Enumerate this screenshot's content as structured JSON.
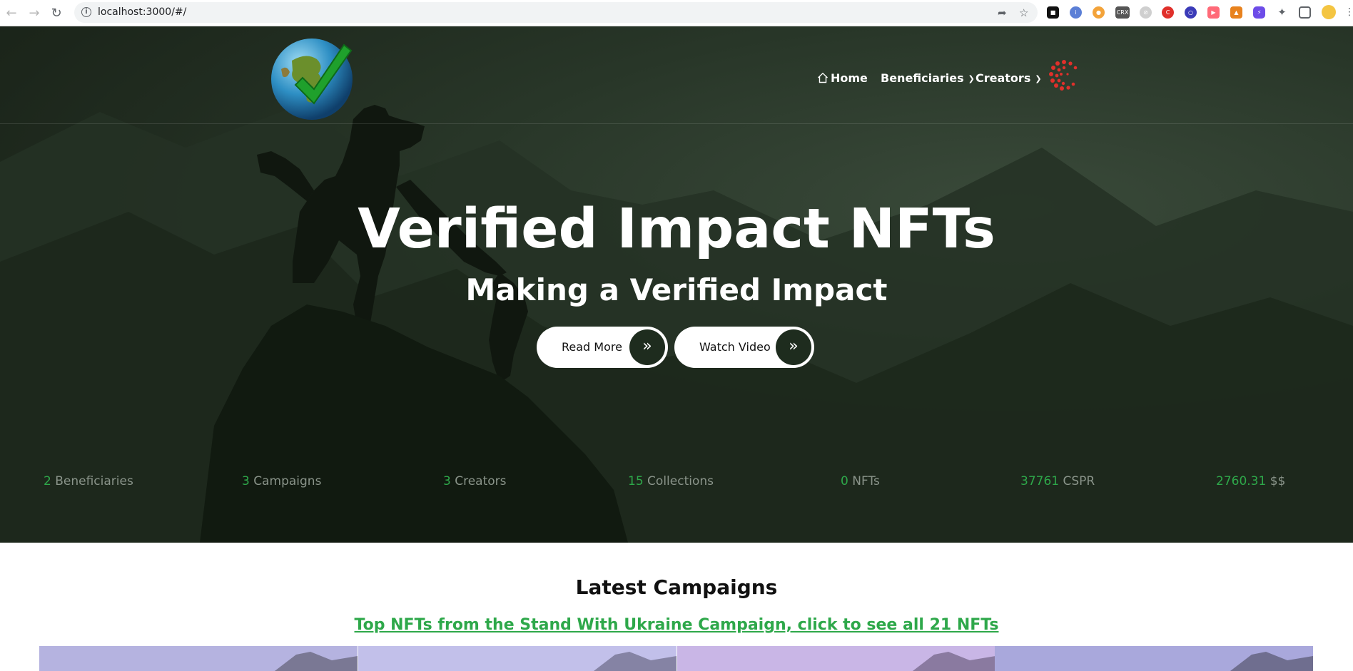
{
  "browser": {
    "url": "localhost:3000/#/",
    "back_icon": "arrow-left-icon",
    "forward_icon": "arrow-right-icon",
    "reload_icon": "reload-icon"
  },
  "nav": {
    "home": "Home",
    "beneficiaries": "Beneficiaries",
    "creators": "Creators"
  },
  "hero": {
    "title": "Verified Impact NFTs",
    "subtitle": "Making a Verified Impact",
    "read_more": "Read More",
    "watch_video": "Watch Video",
    "button_arrow": "»"
  },
  "stats": [
    {
      "value": "2",
      "label": "Beneficiaries"
    },
    {
      "value": "3",
      "label": "Campaigns"
    },
    {
      "value": "3",
      "label": "Creators"
    },
    {
      "value": "15",
      "label": "Collections"
    },
    {
      "value": "0",
      "label": "NFTs"
    },
    {
      "value": "37761",
      "label": "CSPR"
    },
    {
      "value": "2760.31",
      "label": "$$"
    }
  ],
  "latest": {
    "title": "Latest Campaigns",
    "link": "Top NFTs from the Stand With Ukraine Campaign, click to see all 21 NFTs"
  },
  "colors": {
    "accent_green": "#2ea84a",
    "hero_dark": "#1c261b",
    "spinner_red": "#e0302b"
  }
}
